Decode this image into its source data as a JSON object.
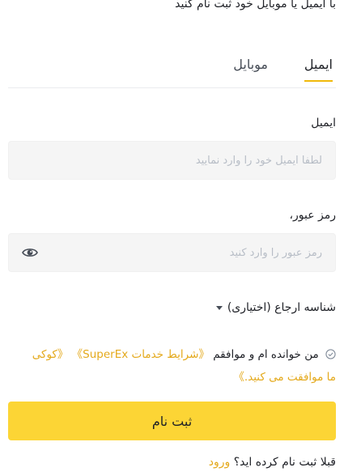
{
  "header": {
    "subtitle": "با ایمیل یا موبایل خود ثبت نام کنید"
  },
  "tabs": [
    {
      "label": "ایمیل",
      "active": true
    },
    {
      "label": "موبایل",
      "active": false
    }
  ],
  "email": {
    "label": "ایمیل",
    "placeholder": "لطفا ایمیل خود را وارد نمایید",
    "value": ""
  },
  "password": {
    "label": "رمز عبور،",
    "placeholder": "رمز عبور را وارد کنید",
    "value": "",
    "toggle_icon": "eye-icon"
  },
  "referral": {
    "label": "شناسه ارجاع (اختیاری)",
    "icon": "caret-down-icon"
  },
  "terms": {
    "prefix": "من خوانده ام و موافقم",
    "service_link": "《شرایط خدمات SuperEx》",
    "cookie_link": "《کوکی",
    "suffix": "ما موافقت می کنید.》",
    "checkbox_icon": "circle-check-icon"
  },
  "submit": {
    "label": "ثبت نام"
  },
  "login": {
    "prompt": "قبلا ثبت نام کرده اید؟",
    "link": "ورود"
  },
  "colors": {
    "accent": "#f0b90b",
    "button": "#fcd535",
    "link": "#e4a91b",
    "field_bg": "#f5f5f5"
  }
}
